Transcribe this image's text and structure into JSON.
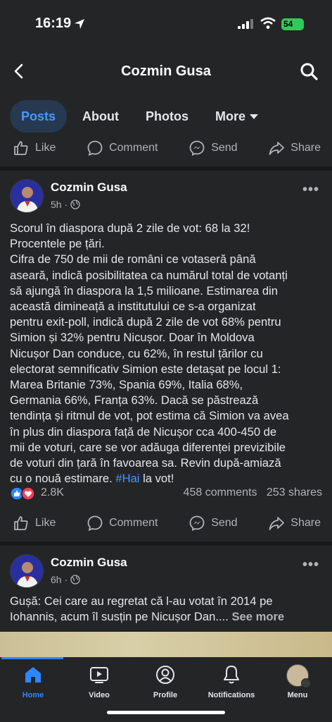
{
  "status": {
    "time": "16:19",
    "battery": "54"
  },
  "header": {
    "title": "Cozmin Gusa"
  },
  "tabs": [
    {
      "label": "Posts"
    },
    {
      "label": "About"
    },
    {
      "label": "Photos"
    },
    {
      "label": "More"
    }
  ],
  "actions": {
    "like": "Like",
    "comment": "Comment",
    "send": "Send",
    "share": "Share"
  },
  "posts": [
    {
      "author": "Cozmin Gusa",
      "time": "5h ·",
      "text_main": "Scorul în diaspora după 2 zile de vot: 68 la 32!\nProcentele pe țări.\nCifra de 750 de mii de români ce votaseră până\naseară, indică posibilitatea ca numărul total de votanți\nsă ajungă în diaspora la 1,5 milioane. Estimarea din\naceastă dimineață a institutului ce s-a organizat\npentru exit-poll, indică după 2 zile de vot 68% pentru\nSimion și 32% pentru Nicușor. Doar în Moldova\nNicușor Dan conduce, cu 62%, în restul țărilor cu\nelectorat semnificativ Simion este detașat pe locul 1:\nMarea Britanie 73%, Spania 69%, Italia 68%,\nGermania 66%, Franța 63%. Dacă se păstrează\ntendința și ritmul de vot, pot estima că Simion va avea\nîn plus din diaspora față de Nicușor cca 400-450 de\nmii de voturi, care se vor adăuga diferenței previzibile\nde voturi din țară în favoarea sa. Revin după-amiază\ncu o nouă estimare. ",
      "hashtag": "#Hai",
      "text_end": " la vot!",
      "reactions": "2.8K",
      "comments": "458 comments",
      "shares": "253 shares"
    },
    {
      "author": "Cozmin Gusa",
      "time": "6h ·",
      "text_main": "Gușă: Cei care au regretat că l-au votat în 2014 pe\nIohannis, acum îl susțin pe Nicușor Dan.... ",
      "see_more": "See more"
    }
  ],
  "bottom_nav": [
    {
      "label": "Home"
    },
    {
      "label": "Video"
    },
    {
      "label": "Profile"
    },
    {
      "label": "Notifications"
    },
    {
      "label": "Menu"
    }
  ],
  "colors": {
    "accent": "#4599ff",
    "background": "#242526",
    "divider": "#18191a",
    "muted": "#b0b3b8"
  }
}
